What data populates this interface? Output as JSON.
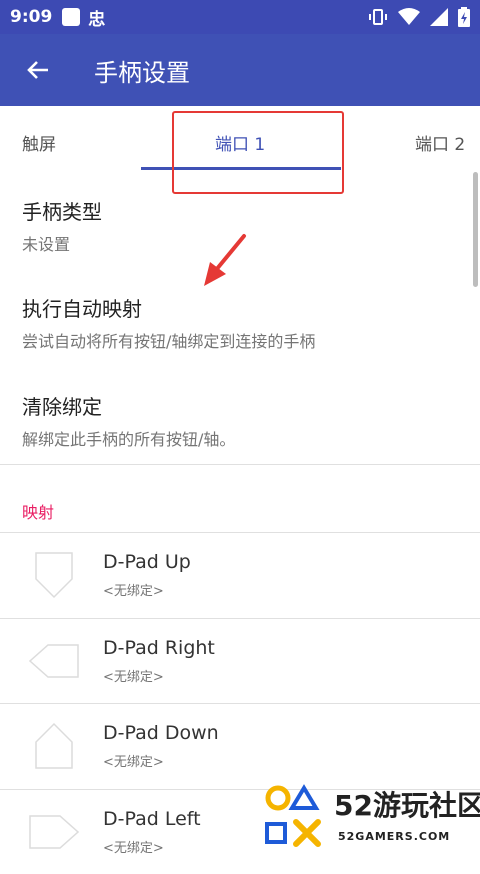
{
  "status_bar": {
    "time": "9:09",
    "app_icon_text": "忠"
  },
  "app_bar": {
    "title": "手柄设置"
  },
  "tabs": [
    {
      "label": "触屏"
    },
    {
      "label": "端口 1"
    },
    {
      "label": "端口 2"
    }
  ],
  "settings": [
    {
      "title": "手柄类型",
      "subtitle": "未设置"
    },
    {
      "title": "执行自动映射",
      "subtitle": "尝试自动将所有按钮/轴绑定到连接的手柄"
    },
    {
      "title": "清除绑定",
      "subtitle": "解绑定此手柄的所有按钮/轴。"
    }
  ],
  "mapping_section": {
    "title": "映射",
    "items": [
      {
        "label": "D-Pad Up",
        "binding": "<无绑定>"
      },
      {
        "label": "D-Pad Right",
        "binding": "<无绑定>"
      },
      {
        "label": "D-Pad Down",
        "binding": "<无绑定>"
      },
      {
        "label": "D-Pad Left",
        "binding": "<无绑定>"
      }
    ]
  },
  "watermark": {
    "title": "52游玩社区",
    "subtitle": "52GAMERS.COM"
  },
  "colors": {
    "primary": "#3f51b5",
    "status_bar": "#3d4ab3",
    "accent": "#e91e63",
    "annotation": "#e53935"
  }
}
